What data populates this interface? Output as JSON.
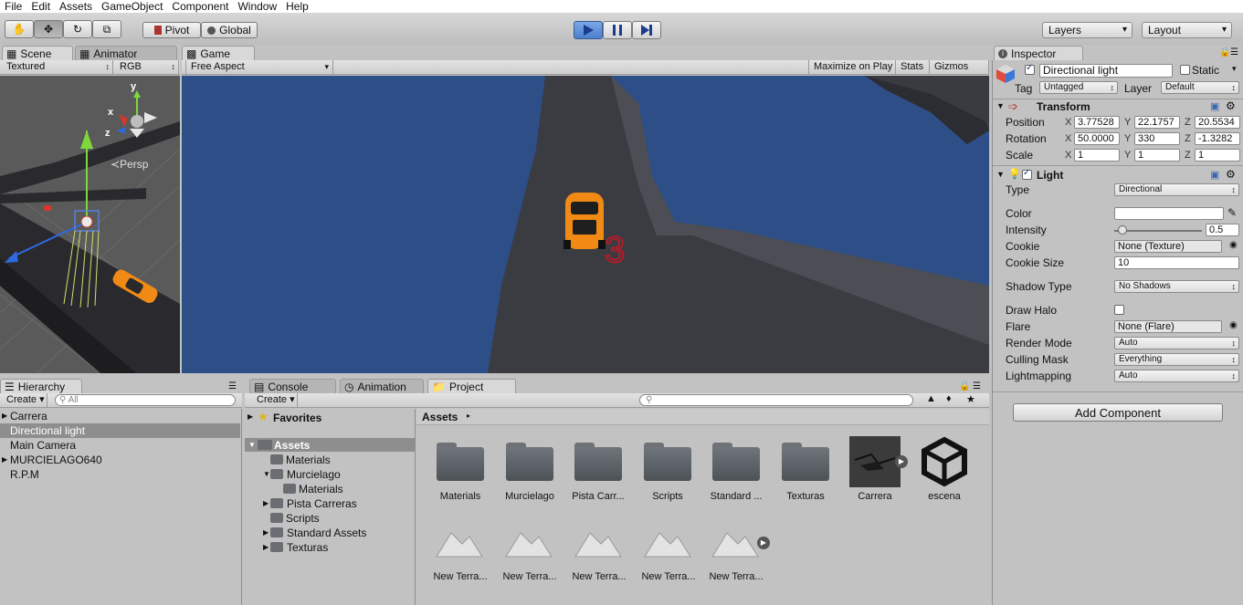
{
  "menu": [
    "File",
    "Edit",
    "Assets",
    "GameObject",
    "Component",
    "Window",
    "Help"
  ],
  "toolbar": {
    "pivot": "Pivot",
    "global": "Global",
    "layers": "Layers",
    "layout": "Layout"
  },
  "scene_panel": {
    "tabs": [
      "Scene",
      "Animator"
    ],
    "render_mode": "Textured",
    "color_mode": "RGB",
    "persp": "Persp",
    "gizmo_axes": [
      "y",
      "x",
      "z"
    ]
  },
  "game_panel": {
    "tab": "Game",
    "aspect": "Free Aspect",
    "maximize": "Maximize on Play",
    "stats": "Stats",
    "gizmos": "Gizmos"
  },
  "hierarchy": {
    "tab": "Hierarchy",
    "create": "Create",
    "search_placeholder": "All",
    "items": [
      {
        "label": "Carrera",
        "expandable": true,
        "selected": false
      },
      {
        "label": "Directional light",
        "expandable": false,
        "selected": true
      },
      {
        "label": "Main Camera",
        "expandable": false,
        "selected": false
      },
      {
        "label": "MURCIELAGO640",
        "expandable": true,
        "selected": false
      },
      {
        "label": "R.P.M",
        "expandable": false,
        "selected": false
      }
    ]
  },
  "bottom_tabs": [
    "Console",
    "Animation",
    "Project"
  ],
  "project": {
    "create": "Create",
    "favorites": "Favorites",
    "assets_root": "Assets",
    "tree": [
      "Materials",
      "Murcielago",
      "Materials",
      "Pista Carreras",
      "Scripts",
      "Standard Assets",
      "Texturas"
    ],
    "breadcrumb": "Assets",
    "grid_row1": [
      "Materials",
      "Murcielago",
      "Pista Carr...",
      "Scripts",
      "Standard ...",
      "Texturas",
      "Carrera",
      "escena"
    ],
    "grid_row2": [
      "New Terra...",
      "New Terra...",
      "New Terra...",
      "New Terra...",
      "New Terra..."
    ]
  },
  "inspector": {
    "tab": "Inspector",
    "object_name": "Directional light",
    "static_label": "Static",
    "tag_label": "Tag",
    "tag_value": "Untagged",
    "layer_label": "Layer",
    "layer_value": "Default",
    "transform": {
      "title": "Transform",
      "position_label": "Position",
      "rotation_label": "Rotation",
      "scale_label": "Scale",
      "position": [
        "3.77528",
        "22.1757",
        "20.5534"
      ],
      "rotation": [
        "50.0000",
        "330",
        "-1.3282"
      ],
      "scale": [
        "1",
        "1",
        "1"
      ]
    },
    "light": {
      "title": "Light",
      "type_label": "Type",
      "type_value": "Directional",
      "color_label": "Color",
      "color_value": "#ffffff",
      "intensity_label": "Intensity",
      "intensity_value": "0.5",
      "cookie_label": "Cookie",
      "cookie_value": "None (Texture)",
      "cookie_size_label": "Cookie Size",
      "cookie_size_value": "10",
      "shadow_label": "Shadow Type",
      "shadow_value": "No Shadows",
      "halo_label": "Draw Halo",
      "flare_label": "Flare",
      "flare_value": "None (Flare)",
      "render_mode_label": "Render Mode",
      "render_mode_value": "Auto",
      "culling_label": "Culling Mask",
      "culling_value": "Everything",
      "lightmapping_label": "Lightmapping",
      "lightmapping_value": "Auto"
    },
    "add_component": "Add Component"
  },
  "colors": {
    "game_bg": "#2d4e86",
    "selection": "#8e8e8e",
    "play_accent": "#4d7fcf"
  }
}
